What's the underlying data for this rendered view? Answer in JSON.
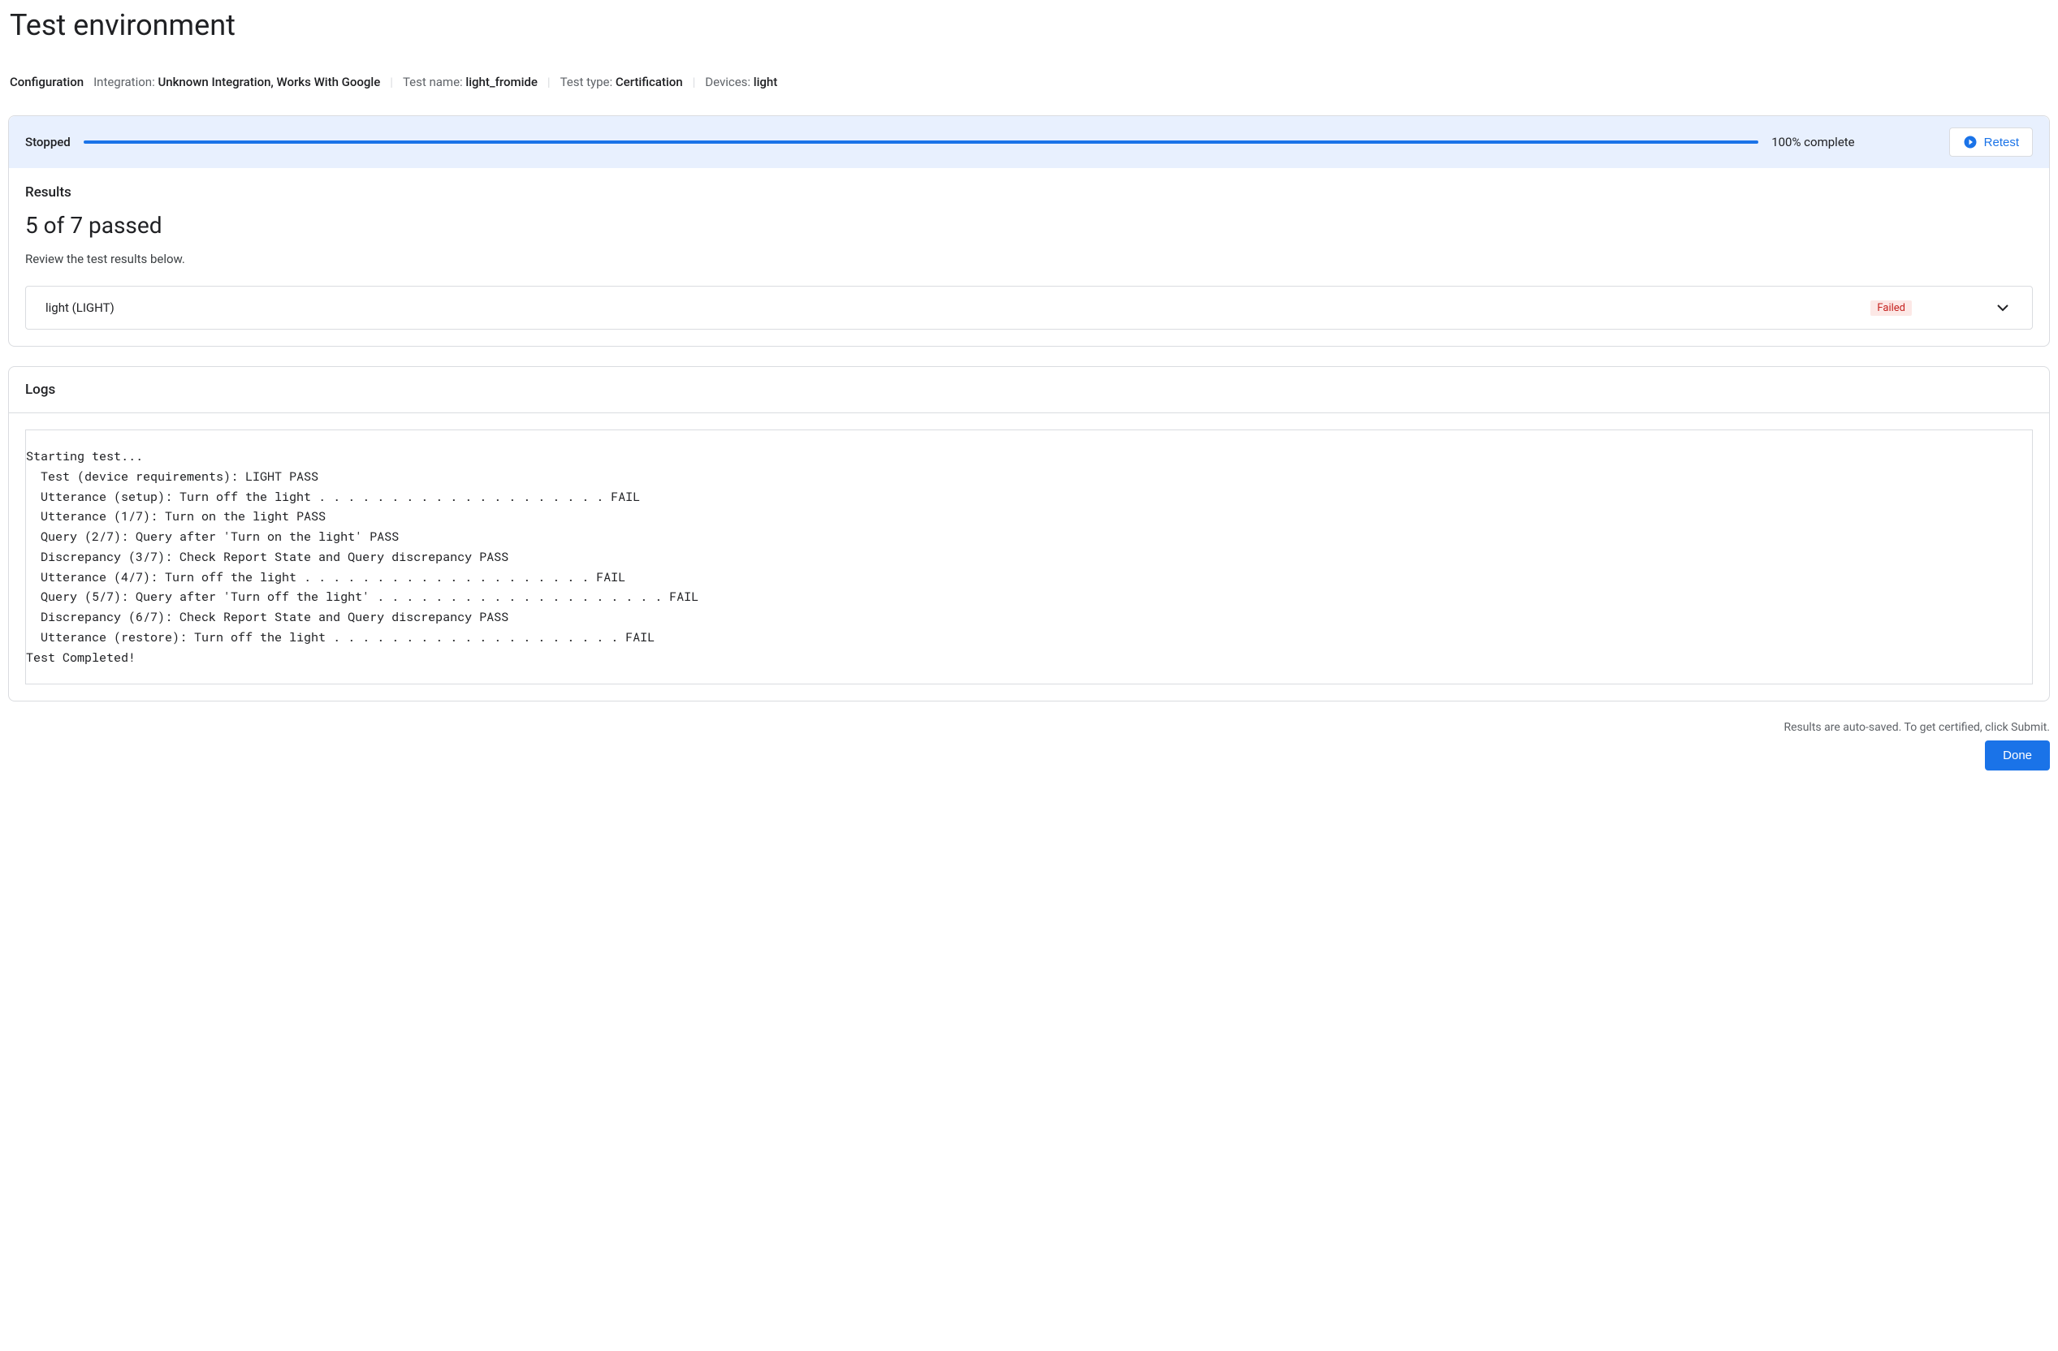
{
  "page_title": "Test environment",
  "config": {
    "heading": "Configuration",
    "integration_label": "Integration:",
    "integration_value": "Unknown Integration, Works With Google",
    "test_name_label": "Test name:",
    "test_name_value": "light_fromide",
    "test_type_label": "Test type:",
    "test_type_value": "Certification",
    "devices_label": "Devices:",
    "devices_value": "light"
  },
  "status": {
    "state": "Stopped",
    "completion": "100% complete",
    "retest_label": "Retest",
    "progress_percent": 100
  },
  "results": {
    "heading": "Results",
    "count_text": "5 of 7 passed",
    "subtext": "Review the test results below.",
    "row_name": "light (LIGHT)",
    "row_status": "Failed"
  },
  "logs": {
    "heading": "Logs",
    "content": "Starting test...\n  Test (device requirements): LIGHT PASS\n  Utterance (setup): Turn off the light . . . . . . . . . . . . . . . . . . . . FAIL\n  Utterance (1/7): Turn on the light PASS\n  Query (2/7): Query after 'Turn on the light' PASS\n  Discrepancy (3/7): Check Report State and Query discrepancy PASS\n  Utterance (4/7): Turn off the light . . . . . . . . . . . . . . . . . . . . FAIL\n  Query (5/7): Query after 'Turn off the light' . . . . . . . . . . . . . . . . . . . . FAIL\n  Discrepancy (6/7): Check Report State and Query discrepancy PASS\n  Utterance (restore): Turn off the light . . . . . . . . . . . . . . . . . . . . FAIL\nTest Completed!"
  },
  "footer": {
    "auto_save_text": "Results are auto-saved. To get certified, click Submit.",
    "done_label": "Done"
  }
}
